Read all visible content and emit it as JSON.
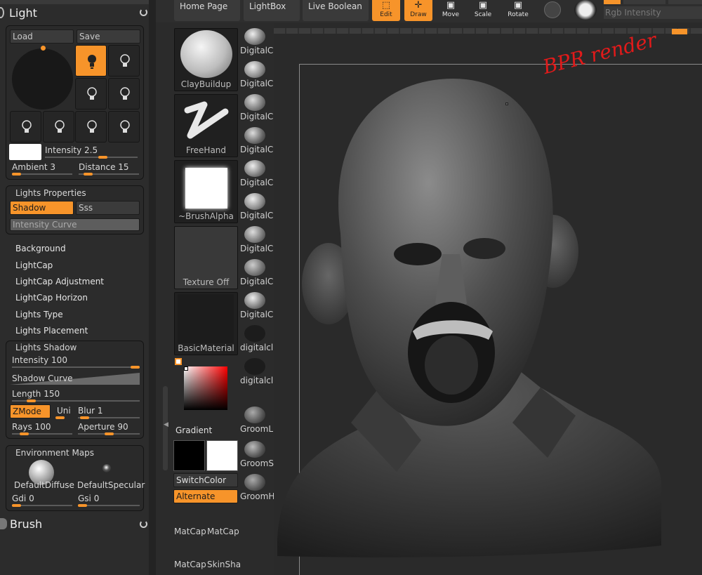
{
  "light_panel": {
    "title": "Light",
    "load": "Load",
    "save": "Save",
    "intensity": "Intensity 2.5",
    "intensity_value": 0.62,
    "ambient": "Ambient 3",
    "ambient_value": 0.03,
    "distance": "Distance 15",
    "distance_value": 0.15
  },
  "lights_properties": {
    "title": "Lights Properties",
    "shadow": "Shadow",
    "sss": "Sss",
    "curve": "Intensity Curve"
  },
  "menu": [
    "Background",
    "LightCap",
    "LightCap Adjustment",
    "LightCap Horizon",
    "Lights Type",
    "Lights Placement"
  ],
  "lights_shadow": {
    "title": "Lights Shadow",
    "intensity": "Intensity 100",
    "intensity_value": 1.0,
    "curve": "Shadow Curve",
    "length": "Length 150",
    "length_value": 0.15,
    "zmode": "ZMode",
    "uni": "Uni",
    "blur": "Blur 1",
    "blur_value": 0.1,
    "rays": "Rays 100",
    "rays_value": 0.2,
    "aperture": "Aperture 90",
    "aperture_value": 0.5
  },
  "env_maps": {
    "title": "Environment Maps",
    "diffuse": "DefaultDiffuse",
    "specular": "DefaultSpecular",
    "gdi": "Gdi 0",
    "gsi": "Gsi 0"
  },
  "brush_title": "Brush",
  "middle": {
    "thumbs": [
      "ClayBuildup",
      "FreeHand",
      "~BrushAlpha",
      "Texture Off",
      "BasicMaterial"
    ],
    "gradient": "Gradient",
    "switchcolor": "SwitchColor",
    "alternate": "Alternate",
    "matcaps": [
      "MatCap",
      "MatCap",
      "MatCap",
      "SkinSha"
    ],
    "smalls": [
      "DigitalC",
      "DigitalC",
      "DigitalC",
      "DigitalC",
      "DigitalC",
      "DigitalC",
      "DigitalC",
      "DigitalC",
      "DigitalC",
      "digitalcla",
      "digitalcla",
      "GroomL",
      "GroomS",
      "GroomH"
    ]
  },
  "topbar": {
    "home": "Home Page",
    "lightbox": "LightBox",
    "liveboolean": "Live Boolean",
    "edit": "Edit",
    "draw": "Draw",
    "move": "Move",
    "scale": "Scale",
    "rotate": "Rotate",
    "rgb_intensity": "Rgb Intensity"
  },
  "annotation": "BPR render",
  "colors": {
    "accent": "#f7942a",
    "annotation": "#e21a1a"
  }
}
